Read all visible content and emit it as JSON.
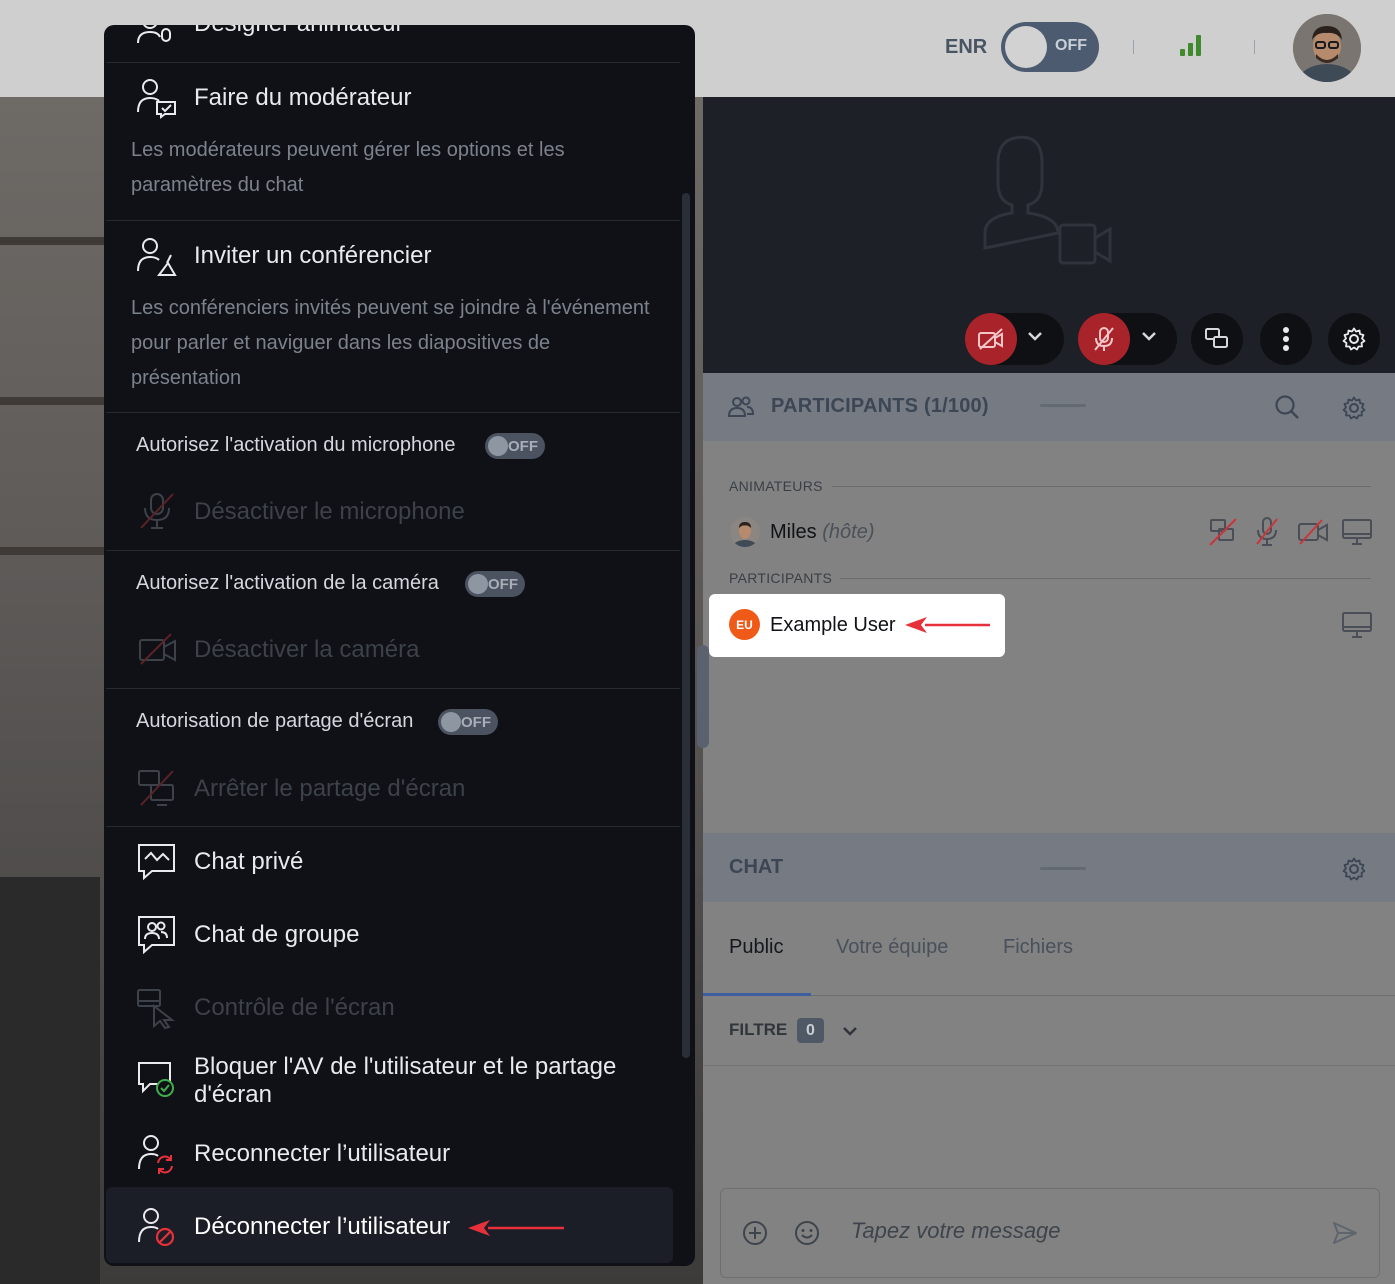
{
  "topbar": {
    "record_label": "ENR",
    "record_toggle_state": "OFF"
  },
  "participants": {
    "title": "PARTICIPANTS (1/100)",
    "hosts_section": "ANIMATEURS",
    "participants_section": "PARTICIPANTS",
    "host": {
      "name": "Miles",
      "tag": "(hôte)"
    },
    "user": {
      "initials": "EU",
      "name": "Example User"
    }
  },
  "chat": {
    "title": "CHAT",
    "tabs": [
      "Public",
      "Votre équipe",
      "Fichiers"
    ],
    "active_tab": "Public",
    "filter_label": "FILTRE",
    "filter_count": "0",
    "message_placeholder": "Tapez votre message"
  },
  "menu": {
    "partial_item": "Désigner animateur",
    "make_moderator": "Faire du modérateur",
    "make_moderator_desc": "Les modérateurs peuvent gérer les options et les paramètres du chat",
    "invite_speaker": "Inviter un conférencier",
    "invite_speaker_desc": "Les conférenciers invités peuvent se joindre à l'événement pour parler et naviguer dans les diapositives de présentation",
    "allow_mic_label": "Autorisez l'activation du microphone",
    "allow_mic_state": "OFF",
    "disable_mic": "Désactiver le microphone",
    "allow_cam_label": "Autorisez l'activation de la caméra",
    "allow_cam_state": "OFF",
    "disable_cam": "Désactiver la caméra",
    "allow_screen_label": "Autorisation de partage d'écran",
    "allow_screen_state": "OFF",
    "stop_screen": "Arrêter le partage d'écran",
    "private_chat": "Chat privé",
    "group_chat": "Chat de groupe",
    "screen_control": "Contrôle de l'écran",
    "block_av": "Bloquer l'AV de l'utilisateur et le partage d'écran",
    "reconnect": "Reconnecter l’utilisateur",
    "disconnect": "Déconnecter l’utilisateur"
  },
  "colors": {
    "menu_bg": "#0f1117",
    "accent_red": "#e8303a",
    "badge_orange": "#f05a18",
    "signal_green": "#3f8a2c"
  }
}
